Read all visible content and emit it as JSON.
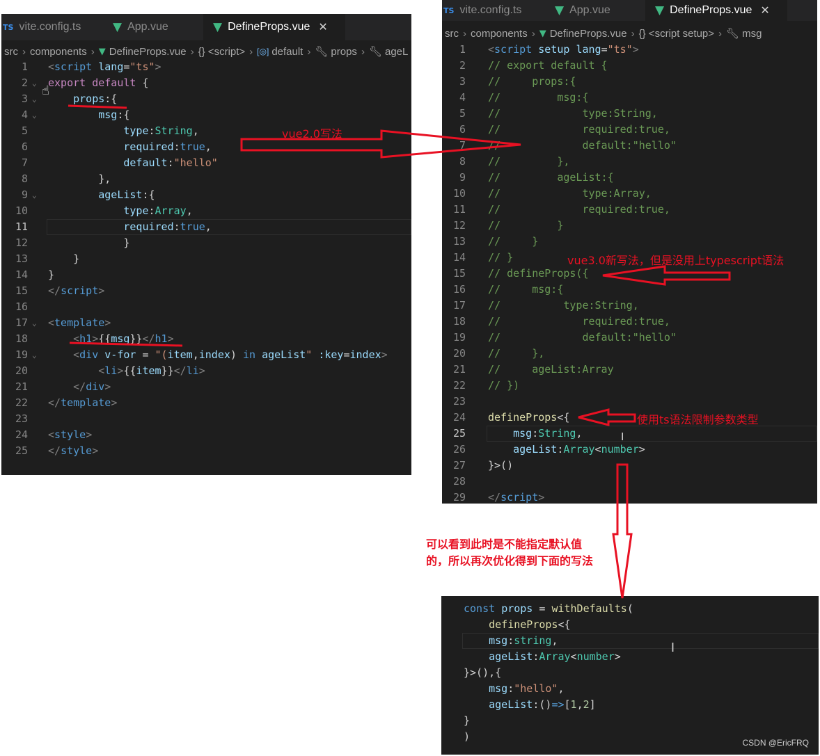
{
  "left_panel": {
    "tabs": [
      {
        "icon": "TS",
        "label": "vite.config.ts"
      },
      {
        "icon": "vue",
        "label": "App.vue"
      },
      {
        "icon": "vue",
        "label": "DefineProps.vue",
        "close": "✕"
      }
    ],
    "breadcrumb": [
      "src",
      "components",
      "DefineProps.vue",
      "{} <script>",
      "default",
      "props",
      "ageL"
    ],
    "lines": [
      {
        "num": "1",
        "html": "<span class='g'>&lt;</span><span class='t'>script</span> <span class='a'>lang</span>=<span class='s'>\"ts\"</span><span class='g'>&gt;</span>"
      },
      {
        "num": "2",
        "html": "<span class='c'>export</span> <span class='c'>default</span> {"
      },
      {
        "num": "3",
        "html": "    <span class='a'>props</span>:{"
      },
      {
        "num": "4",
        "html": "        <span class='a'>msg</span>:{"
      },
      {
        "num": "5",
        "html": "            <span class='a'>type</span>:<span class='y'>String</span>,"
      },
      {
        "num": "6",
        "html": "            <span class='a'>required</span>:<span class='k'>true</span>,"
      },
      {
        "num": "7",
        "html": "            <span class='a'>default</span>:<span class='s'>\"hello\"</span>"
      },
      {
        "num": "8",
        "html": "        },"
      },
      {
        "num": "9",
        "html": "        <span class='a'>ageList</span>:{"
      },
      {
        "num": "10",
        "html": "            <span class='a'>type</span>:<span class='y'>Array</span>,"
      },
      {
        "num": "11",
        "html": "            <span class='a'>required</span>:<span class='k'>true</span>,"
      },
      {
        "num": "12",
        "html": "            }"
      },
      {
        "num": "13",
        "html": "    }"
      },
      {
        "num": "14",
        "html": "}"
      },
      {
        "num": "15",
        "html": "<span class='g'>&lt;/</span><span class='t'>script</span><span class='g'>&gt;</span>"
      },
      {
        "num": "16",
        "html": ""
      },
      {
        "num": "17",
        "html": "<span class='g'>&lt;</span><span class='t'>template</span><span class='g'>&gt;</span>"
      },
      {
        "num": "18",
        "html": "    <span class='g'>&lt;</span><span class='t'>h1</span><span class='g'>&gt;</span>{{<span class='a'>msg</span>}}<span class='g'>&lt;/</span><span class='t'>h1</span><span class='g'>&gt;</span>"
      },
      {
        "num": "19",
        "html": "    <span class='g'>&lt;</span><span class='t'>div</span> <span class='a'>v-for</span> = <span class='s'>\"(</span><span class='a'>item</span>,<span class='a'>index</span>) <span class='k'>in</span> <span class='a'>ageList</span><span class='s'>\"</span> <span class='a'>:key</span>=<span class='a'>index</span><span class='g'>&gt;</span>"
      },
      {
        "num": "20",
        "html": "        <span class='g'>&lt;</span><span class='t'>li</span><span class='g'>&gt;</span>{{<span class='a'>item</span>}}<span class='g'>&lt;/</span><span class='t'>li</span><span class='g'>&gt;</span>"
      },
      {
        "num": "21",
        "html": "    <span class='g'>&lt;/</span><span class='t'>div</span><span class='g'>&gt;</span>"
      },
      {
        "num": "22",
        "html": "<span class='g'>&lt;/</span><span class='t'>template</span><span class='g'>&gt;</span>"
      },
      {
        "num": "23",
        "html": ""
      },
      {
        "num": "24",
        "html": "<span class='g'>&lt;</span><span class='t'>style</span><span class='g'>&gt;</span>"
      },
      {
        "num": "25",
        "html": "<span class='g'>&lt;/</span><span class='t'>style</span><span class='g'>&gt;</span>"
      }
    ]
  },
  "right_panel": {
    "tabs": [
      {
        "icon": "TS",
        "label": "vite.config.ts"
      },
      {
        "icon": "vue",
        "label": "App.vue"
      },
      {
        "icon": "vue",
        "label": "DefineProps.vue",
        "close": "✕"
      }
    ],
    "breadcrumb": [
      "src",
      "components",
      "DefineProps.vue",
      "{} <script setup>",
      "msg"
    ],
    "lines": [
      {
        "num": "1",
        "html": "<span class='g'>&lt;</span><span class='t'>script</span> <span class='a'>setup</span> <span class='a'>lang</span>=<span class='s'>\"ts\"</span><span class='g'>&gt;</span>"
      },
      {
        "num": "2",
        "html": "<span class='cm'>// export default {</span>"
      },
      {
        "num": "3",
        "html": "<span class='cm'>//     props:{</span>"
      },
      {
        "num": "4",
        "html": "<span class='cm'>//         msg:{</span>"
      },
      {
        "num": "5",
        "html": "<span class='cm'>//             type:String,</span>"
      },
      {
        "num": "6",
        "html": "<span class='cm'>//             required:true,</span>"
      },
      {
        "num": "7",
        "html": "<span class='cm'>//             default:\"hello\"</span>"
      },
      {
        "num": "8",
        "html": "<span class='cm'>//         },</span>"
      },
      {
        "num": "9",
        "html": "<span class='cm'>//         ageList:{</span>"
      },
      {
        "num": "10",
        "html": "<span class='cm'>//             type:Array,</span>"
      },
      {
        "num": "11",
        "html": "<span class='cm'>//             required:true,</span>"
      },
      {
        "num": "12",
        "html": "<span class='cm'>//         }</span>"
      },
      {
        "num": "13",
        "html": "<span class='cm'>//     }</span>"
      },
      {
        "num": "14",
        "html": "<span class='cm'>// }</span>"
      },
      {
        "num": "15",
        "html": "<span class='cm'>// defineProps({</span>"
      },
      {
        "num": "16",
        "html": "<span class='cm'>//     msg:{</span>"
      },
      {
        "num": "17",
        "html": "<span class='cm'>//          type:String,</span>"
      },
      {
        "num": "18",
        "html": "<span class='cm'>//             required:true,</span>"
      },
      {
        "num": "19",
        "html": "<span class='cm'>//             default:\"hello\"</span>"
      },
      {
        "num": "20",
        "html": "<span class='cm'>//     },</span>"
      },
      {
        "num": "21",
        "html": "<span class='cm'>//     ageList:Array</span>"
      },
      {
        "num": "22",
        "html": "<span class='cm'>// })</span>"
      },
      {
        "num": "23",
        "html": ""
      },
      {
        "num": "24",
        "html": "<span class='f'>defineProps</span>&lt;{"
      },
      {
        "num": "25",
        "html": "    <span class='a'>msg</span>:<span class='y'>String</span>,"
      },
      {
        "num": "26",
        "html": "    <span class='a'>ageList</span>:<span class='y'>Array</span>&lt;<span class='y'>number</span>&gt;"
      },
      {
        "num": "27",
        "html": "}&gt;()"
      },
      {
        "num": "28",
        "html": ""
      },
      {
        "num": "29",
        "html": "<span class='g'>&lt;/</span><span class='t'>script</span><span class='g'>&gt;</span>"
      }
    ]
  },
  "bottom_panel": {
    "lines": [
      {
        "html": "<span class='k'>const</span> <span class='a'>props</span> = <span class='f'>withDefaults</span>("
      },
      {
        "html": "    <span class='f'>defineProps</span>&lt;{"
      },
      {
        "html": "    <span class='a'>msg</span>:<span class='y'>string</span>,"
      },
      {
        "html": "    <span class='a'>ageList</span>:<span class='y'>Array</span>&lt;<span class='y'>number</span>&gt;"
      },
      {
        "html": "}&gt;(),{"
      },
      {
        "html": "    <span class='a'>msg</span>:<span class='s'>\"hello\"</span>,"
      },
      {
        "html": "    <span class='a'>ageList</span>:()<span class='k'>=&gt;</span>[<span class='n'>1</span>,<span class='n'>2</span>]"
      },
      {
        "html": "}"
      },
      {
        "html": ")"
      }
    ]
  },
  "annotations": {
    "vue2": "vue2.0写法",
    "vue3": "vue3.0新写法，但是没用上typescript语法",
    "ts": "使用ts语法限制参数类型",
    "note_line1": "可以看到此时是不能指定默认值",
    "note_line2": "的，所以再次优化得到下面的写法"
  },
  "watermark": "CSDN @EricFRQ",
  "colors": {
    "annotation_red": "#e81123",
    "editor_bg": "#1e1e1e",
    "tab_bg": "#252526"
  }
}
